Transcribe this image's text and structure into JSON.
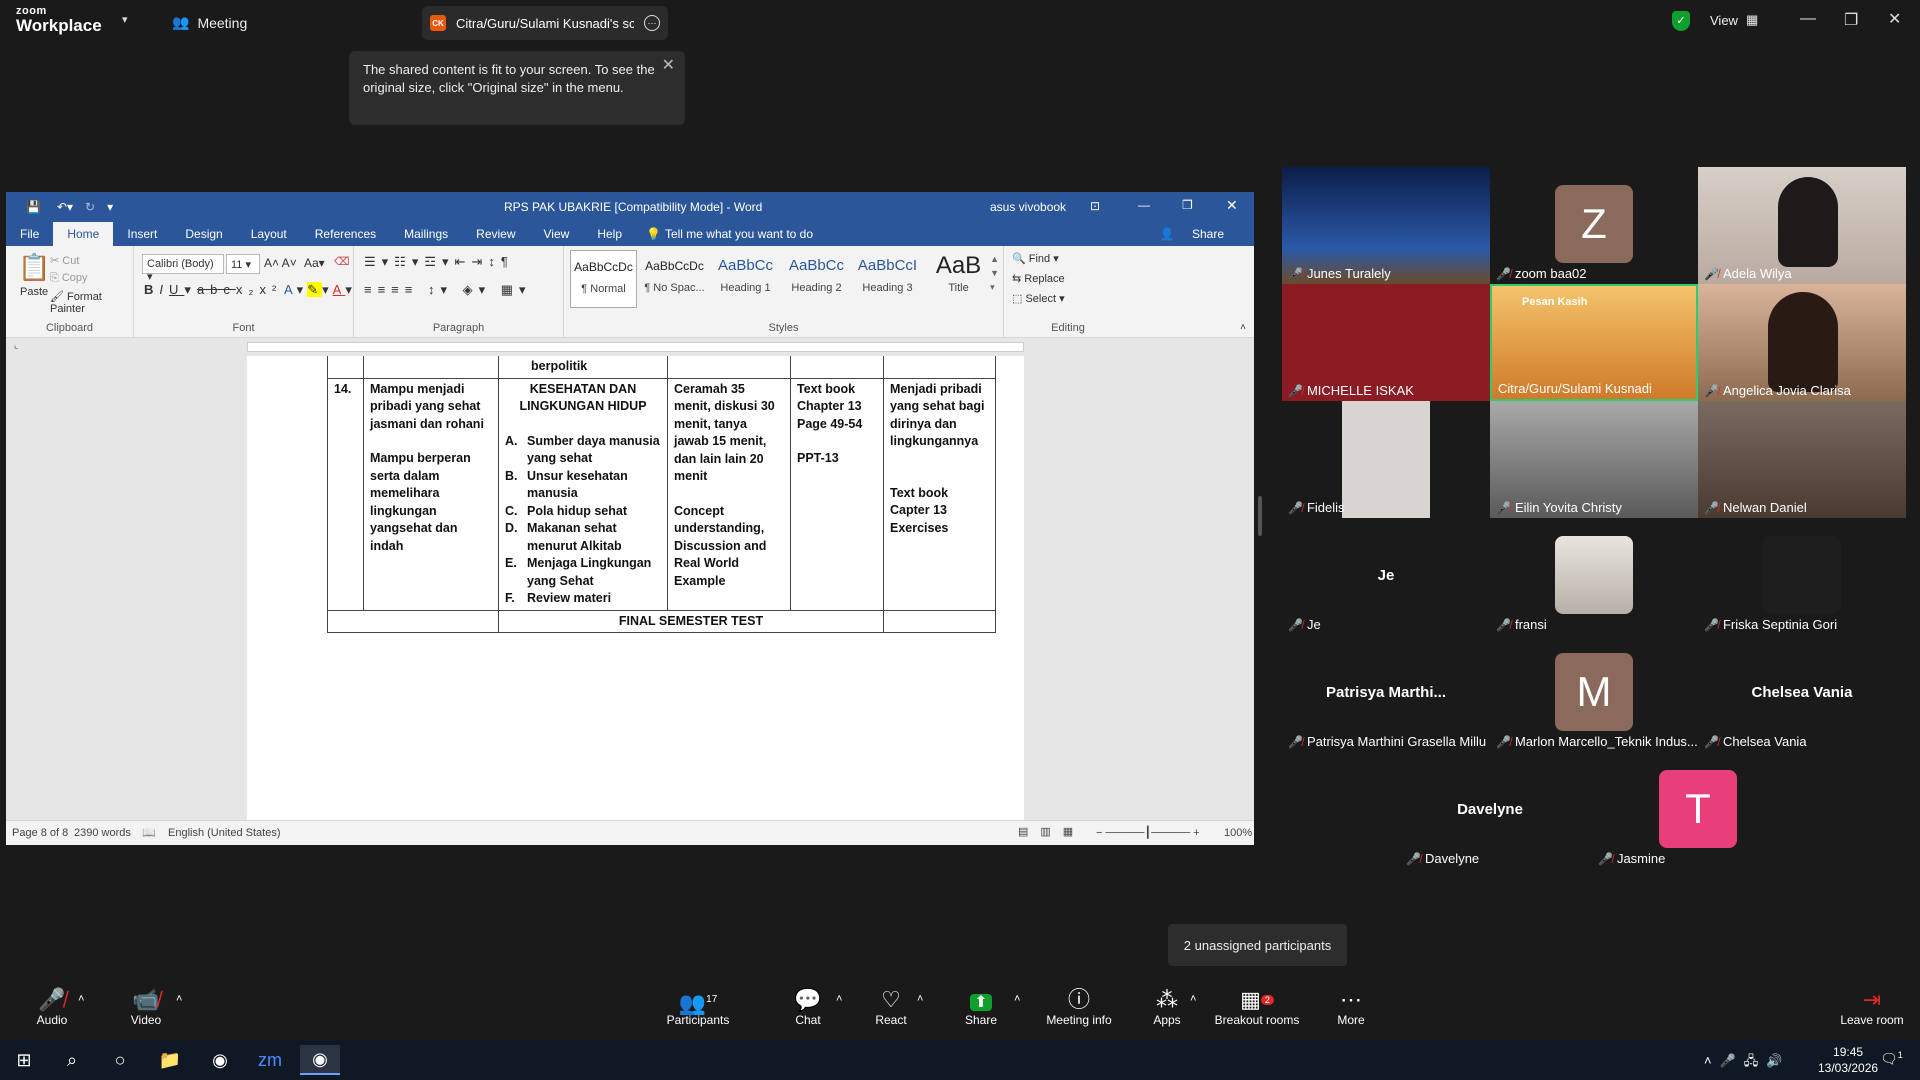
{
  "zoom": {
    "logo_top": "zoom",
    "logo_bottom": "Workplace",
    "meeting_label": "Meeting",
    "share_tab_badge": "CK",
    "share_tab_label": "Citra/Guru/Sulami Kusnadi's scre",
    "view_label": "View",
    "tooltip": "The shared content is fit to your screen. To see the original size, click \"Original size\" in the menu.",
    "unassigned": "2 unassigned participants"
  },
  "word": {
    "title": "RPS PAK UBAKRIE [Compatibility Mode] - Word",
    "user": "asus vivobook",
    "share": "Share",
    "tabs": [
      "File",
      "Home",
      "Insert",
      "Design",
      "Layout",
      "References",
      "Mailings",
      "Review",
      "View",
      "Help"
    ],
    "tell_me": "Tell me what you want to do",
    "clipboard": {
      "paste": "Paste",
      "cut": "Cut",
      "copy": "Copy",
      "format_painter": "Format Painter",
      "label": "Clipboard"
    },
    "font": {
      "name": "Calibri (Body)",
      "size": "11",
      "label": "Font"
    },
    "paragraph_label": "Paragraph",
    "styles": [
      {
        "preview": "AaBbCcDc",
        "name": "¶ Normal"
      },
      {
        "preview": "AaBbCcDc",
        "name": "¶ No Spac..."
      },
      {
        "preview": "AaBbCc",
        "name": "Heading 1"
      },
      {
        "preview": "AaBbCc",
        "name": "Heading 2"
      },
      {
        "preview": "AaBbCcI",
        "name": "Heading 3"
      },
      {
        "preview": "AaB",
        "name": "Title"
      }
    ],
    "styles_label": "Styles",
    "editing": {
      "find": "Find",
      "replace": "Replace",
      "select": "Select",
      "label": "Editing"
    },
    "status": {
      "page": "Page 8 of 8",
      "words": "2390 words",
      "language": "English (United States)",
      "zoom": "100%"
    },
    "table": {
      "top_row": "berpolitik",
      "row14": {
        "num": "14.",
        "col1a": "Mampu menjadi pribadi yang sehat jasmani dan rohani",
        "col1b": "Mampu berperan serta dalam memelihara lingkungan yangsehat dan indah",
        "col2_title": "KESEHATAN DAN LINGKUNGAN HIDUP",
        "col2_items": [
          {
            "mark": "A.",
            "text": "Sumber daya manusia yang sehat"
          },
          {
            "mark": "B.",
            "text": "Unsur kesehatan manusia"
          },
          {
            "mark": "C.",
            "text": "Pola hidup sehat"
          },
          {
            "mark": "D.",
            "text": "Makanan sehat menurut Alkitab"
          },
          {
            "mark": "E.",
            "text": "Menjaga Lingkungan yang Sehat"
          },
          {
            "mark": "F.",
            "text": "Review materi"
          }
        ],
        "col3a": "Ceramah  35 menit, diskusi 30 menit, tanya jawab 15 menit, dan lain lain 20 menit",
        "col3b": "Concept understanding, Discussion and Real World Example",
        "col4a": "Text book Chapter 13 Page 49-54",
        "col4b": "PPT-13",
        "col5a": "Menjadi pribadi yang sehat bagi dirinya dan lingkungannya",
        "col5b": "Text book Capter 13 Exercises"
      },
      "final": "FINAL SEMESTER TEST"
    }
  },
  "participants": {
    "count": "17",
    "tiles": [
      {
        "name": "Junes Turalely"
      },
      {
        "name": "zoom baa02",
        "initial": "Z"
      },
      {
        "name": "Adela Wilya"
      },
      {
        "name": "MICHELLE ISKAK"
      },
      {
        "name": "Citra/Guru/Sulami Kusnadi",
        "banner": "Pesan Kasih"
      },
      {
        "name": "Angelica Jovia Clarisa"
      },
      {
        "name": "Fidelis"
      },
      {
        "name": "Eilin Yovita Christy"
      },
      {
        "name": "Nelwan Daniel"
      },
      {
        "name": "Je",
        "big": "Je"
      },
      {
        "name": "fransi"
      },
      {
        "name": "Friska Septinia Gori"
      },
      {
        "name": "Patrisya Marthini Grasella Millu",
        "big": "Patrisya  Marthi..."
      },
      {
        "name": "Marlon Marcello_Teknik Indus...",
        "initial": "M"
      },
      {
        "name": "Chelsea Vania",
        "big": "Chelsea Vania"
      },
      {
        "name": "Davelyne",
        "big": "Davelyne"
      },
      {
        "name": "Jasmine",
        "initial": "T"
      }
    ]
  },
  "toolbar": {
    "audio": "Audio",
    "video": "Video",
    "participants": "Participants",
    "chat": "Chat",
    "react": "React",
    "share": "Share",
    "meeting_info": "Meeting info",
    "apps": "Apps",
    "breakout": "Breakout rooms",
    "breakout_badge": "2",
    "more": "More",
    "leave": "Leave room"
  },
  "taskbar": {
    "time": "19:45",
    "date": "13/03/2026",
    "notif": "1"
  },
  "colors": {
    "word_blue": "#2b579a",
    "zoom_green": "#0e9f2f",
    "avatar_brown": "#8a6a5a",
    "avatar_pink": "#e83e7a",
    "mute_red": "#e02828"
  }
}
